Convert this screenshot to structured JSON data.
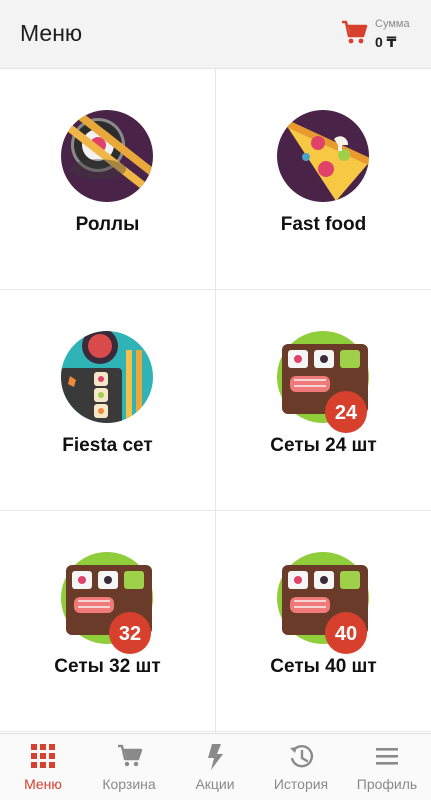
{
  "header": {
    "title": "Меню",
    "sum_label": "Сумма",
    "sum_value": "0 ₸"
  },
  "categories": [
    {
      "name": "Роллы",
      "icon": "rolls-icon"
    },
    {
      "name": "Fast food",
      "icon": "pizza-icon"
    },
    {
      "name": "Fiesta сет",
      "icon": "fiesta-set-icon"
    },
    {
      "name": "Сеты 24 шт",
      "icon": "set-icon",
      "badge": "24"
    },
    {
      "name": "Сеты 32 шт",
      "icon": "set-icon",
      "badge": "32"
    },
    {
      "name": "Сеты 40 шт",
      "icon": "set-icon",
      "badge": "40"
    }
  ],
  "tabs": [
    {
      "label": "Меню",
      "icon": "grid-icon",
      "active": true
    },
    {
      "label": "Корзина",
      "icon": "cart-icon",
      "active": false
    },
    {
      "label": "Акции",
      "icon": "lightning-icon",
      "active": false
    },
    {
      "label": "История",
      "icon": "history-icon",
      "active": false
    },
    {
      "label": "Профиль",
      "icon": "menu-lines-icon",
      "active": false
    }
  ],
  "colors": {
    "accent": "#d7402d",
    "inactive": "#8a8a8a",
    "header_bg": "#f3f3f3"
  }
}
